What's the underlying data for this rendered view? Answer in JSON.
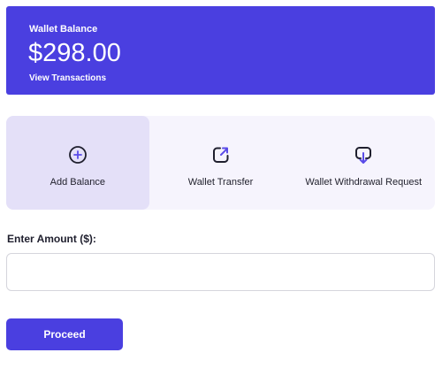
{
  "wallet": {
    "label": "Wallet Balance",
    "amount": "$298.00",
    "view_transactions": "View Transactions"
  },
  "actions": [
    {
      "label": "Add Balance",
      "icon": "plus-circle-icon",
      "active": true
    },
    {
      "label": "Wallet Transfer",
      "icon": "transfer-out-icon",
      "active": false
    },
    {
      "label": "Wallet Withdrawal Request",
      "icon": "withdraw-icon",
      "active": false
    }
  ],
  "amount_field": {
    "label": "Enter Amount ($):",
    "value": "",
    "placeholder": ""
  },
  "proceed": {
    "label": "Proceed"
  },
  "colors": {
    "accent": "#4a3fe0",
    "active_tile": "#e4e0f8",
    "tile_background": "#f6f4fd",
    "icon_stroke": "#1f1f2e",
    "icon_accent": "#5a4be8"
  }
}
